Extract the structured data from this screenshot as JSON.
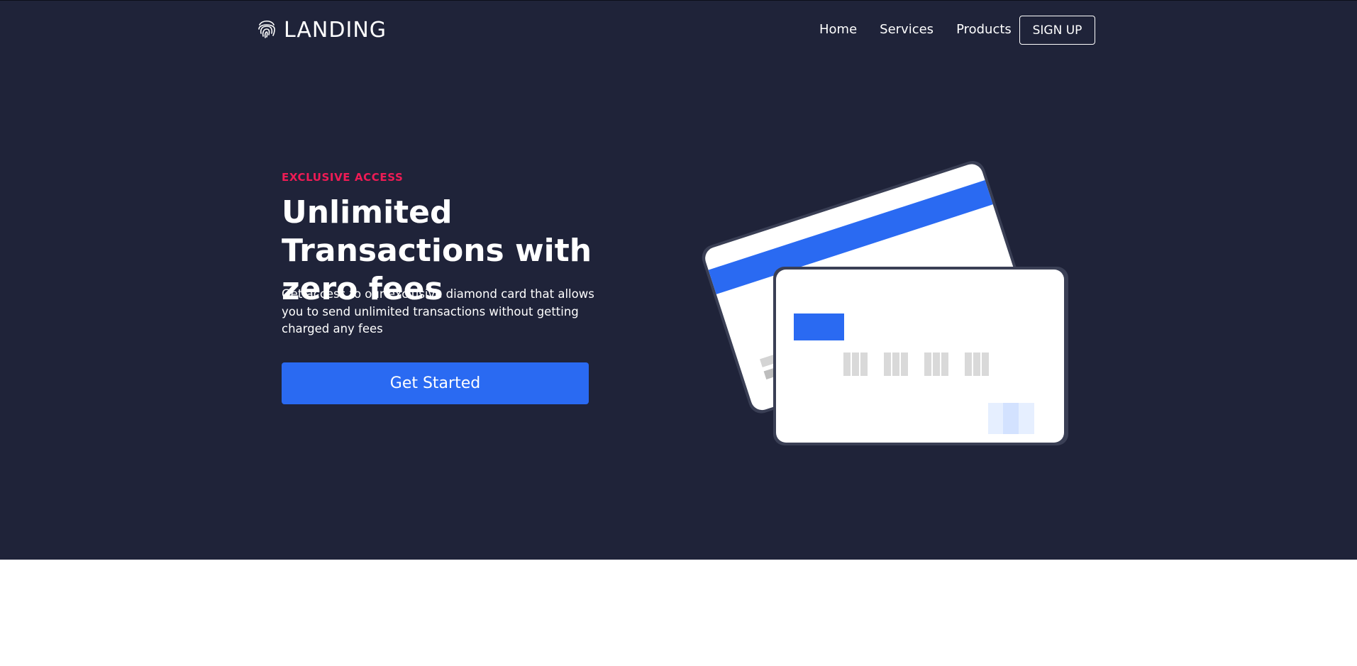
{
  "nav": {
    "logo_text": "LANDING",
    "logo_icon": "fingerprint-icon",
    "links": [
      {
        "label": "Home"
      },
      {
        "label": "Services"
      },
      {
        "label": "Products"
      }
    ],
    "signup_label": "SIGN UP"
  },
  "hero": {
    "eyebrow": "EXCLUSIVE ACCESS",
    "headline": "Unlimited Transactions with zero fees",
    "description": "Get access to our exclusive diamond card that allows you to send unlimited transactions without getting charged any fees",
    "cta_label": "Get Started",
    "illustration": "credit-cards-illustration"
  },
  "colors": {
    "hero_background": "#1f2339",
    "accent_blue": "#2a6af2",
    "eyebrow_red": "#ef1b55",
    "below_fold": "#ffffff"
  }
}
